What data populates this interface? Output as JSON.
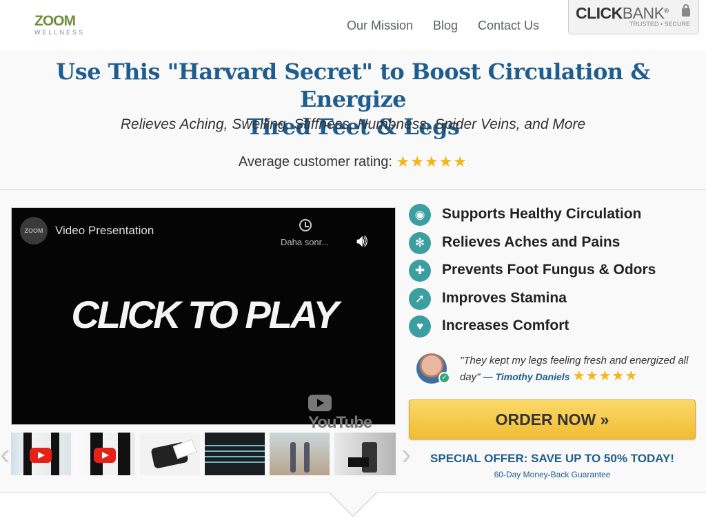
{
  "header": {
    "logo_main": "ZOOM",
    "logo_sub": "WELLNESS",
    "nav": [
      "Our Mission",
      "Blog",
      "Contact Us"
    ],
    "clickbank_bold": "CLICK",
    "clickbank_light": "BANK",
    "clickbank_reg": "®",
    "clickbank_sub": "TRUSTED • SECURE"
  },
  "hero": {
    "title_line1": "Use This \"Harvard Secret\" to Boost Circulation & Energize",
    "title_line2": "Tired Feet & Legs",
    "subtitle": "Relieves Aching, Swelling, Stiffness, Numbness, Spider Veins, and More",
    "rating_label": "Average customer rating:",
    "rating_value": 4.5,
    "rating_stars": "★★★★★"
  },
  "video": {
    "channel_logo": "ZOOM",
    "title": "Video Presentation",
    "watch_later": "Daha sonr...",
    "play_text": "CLICK TO PLAY",
    "brand": "YouTube"
  },
  "features": [
    {
      "label": "Supports Healthy Circulation",
      "icon": "drop-icon",
      "glyph": "◉"
    },
    {
      "label": "Relieves Aches and Pains",
      "icon": "snowflake-icon",
      "glyph": "✻"
    },
    {
      "label": "Prevents Foot Fungus & Odors",
      "icon": "shield-plus-icon",
      "glyph": "✚"
    },
    {
      "label": "Improves Stamina",
      "icon": "runner-icon",
      "glyph": "➚"
    },
    {
      "label": "Increases Comfort",
      "icon": "heart-hand-icon",
      "glyph": "♥"
    }
  ],
  "testimonial": {
    "quote": "\"They kept my legs feeling fresh and energized all day\"",
    "author": "— Timothy Daniels",
    "stars": "★★★★★",
    "verified": "✓"
  },
  "cta": {
    "order_label": "ORDER NOW »",
    "offer": "SPECIAL OFFER: SAVE UP TO 50% TODAY!",
    "guarantee": "60-Day Money-Back Guarantee"
  },
  "colors": {
    "primary_blue": "#1f5d8e",
    "teal": "#3b9ea0",
    "star_gold": "#f3b619",
    "button_gold": "#f1bc33"
  }
}
